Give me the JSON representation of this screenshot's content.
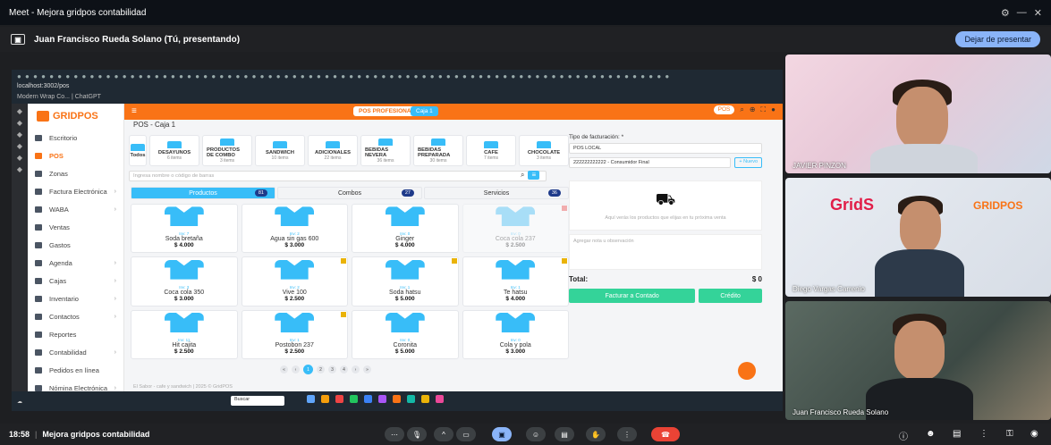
{
  "window": {
    "title": "Meet - Mejora gridpos contabilidad"
  },
  "presenting": {
    "label": "Juan Francisco Rueda Solano (Tú, presentando)",
    "stop_button": "Dejar de presentar"
  },
  "browser": {
    "url": "localhost:3002/pos",
    "bookmarks": "Modern Wrap Co... | ChatGPT",
    "ext_text": "PROD - Co..."
  },
  "app": {
    "logo": "GRIDPOS",
    "badge_profesional": "POS PROFESIONAL",
    "badge_caja": "Caja 1",
    "pos_pill": "POS",
    "page_title": "POS - Caja 1",
    "sidebar": [
      {
        "label": "Escritorio",
        "chev": ""
      },
      {
        "label": "POS",
        "chev": "",
        "active": true
      },
      {
        "label": "Zonas",
        "chev": ""
      },
      {
        "label": "Factura Electrónica",
        "chev": "›"
      },
      {
        "label": "WABA",
        "chev": "›"
      },
      {
        "label": "Ventas",
        "chev": ""
      },
      {
        "label": "Gastos",
        "chev": ""
      },
      {
        "label": "Agenda",
        "chev": "›"
      },
      {
        "label": "Cajas",
        "chev": "›"
      },
      {
        "label": "Inventario",
        "chev": "›"
      },
      {
        "label": "Contactos",
        "chev": "›"
      },
      {
        "label": "Reportes",
        "chev": ""
      },
      {
        "label": "Contabilidad",
        "chev": "›"
      },
      {
        "label": "Pedidos en línea",
        "chev": ""
      },
      {
        "label": "Nómina Electrónica",
        "chev": "›"
      },
      {
        "label": "Adquisiciones",
        "chev": "›"
      },
      {
        "label": "Configuración",
        "chev": "›"
      },
      {
        "label": "Facturación",
        "chev": "›"
      }
    ],
    "categories": [
      {
        "name": "Todos",
        "count": ""
      },
      {
        "name": "DESAYUNOS",
        "count": "6 items"
      },
      {
        "name": "PRODUCTOS DE COMBO",
        "count": "3 items"
      },
      {
        "name": "SANDWICH",
        "count": "10 items"
      },
      {
        "name": "ADICIONALES",
        "count": "22 items"
      },
      {
        "name": "BEBIDAS NEVERA",
        "count": "36 items"
      },
      {
        "name": "BEBIDAS PREPARADA",
        "count": "30 items"
      },
      {
        "name": "CAFE",
        "count": "7 items"
      },
      {
        "name": "CHOCOLATE",
        "count": "3 items"
      }
    ],
    "search_placeholder": "Ingresa nombre o código de barras",
    "tabs": [
      {
        "label": "Productos",
        "count": "81"
      },
      {
        "label": "Combos",
        "count": "27"
      },
      {
        "label": "Servicios",
        "count": "36"
      }
    ],
    "products": [
      {
        "inv": "Inv: 7",
        "name": "Soda bretaña",
        "price": "$ 4.000",
        "badge": ""
      },
      {
        "inv": "Inv: 2",
        "name": "Agua sin gas 600",
        "price": "$ 3.000",
        "badge": ""
      },
      {
        "inv": "Inv: 0",
        "name": "Ginger",
        "price": "$ 4.000",
        "badge": ""
      },
      {
        "inv": "Inv: 0",
        "name": "Coca cola 237",
        "price": "$ 2.500",
        "badge": "red",
        "faded": true
      },
      {
        "inv": "Inv: 3",
        "name": "Coca cola 350",
        "price": "$ 3.000",
        "badge": ""
      },
      {
        "inv": "Inv: 2",
        "name": "Vive 100",
        "price": "$ 2.500",
        "badge": "yellow"
      },
      {
        "inv": "Inv: 1",
        "name": "Soda hatsu",
        "price": "$ 5.000",
        "badge": "yellow"
      },
      {
        "inv": "Inv: 1",
        "name": "Te hatsu",
        "price": "$ 4.000",
        "badge": "yellow"
      },
      {
        "inv": "Inv: 11",
        "name": "Hit cajita",
        "price": "$ 2.500",
        "badge": ""
      },
      {
        "inv": "Inv: 1",
        "name": "Postobon 237",
        "price": "$ 2.500",
        "badge": "yellow"
      },
      {
        "inv": "Inv: 0",
        "name": "Coronita",
        "price": "$ 5.000",
        "badge": ""
      },
      {
        "inv": "Inv: 0",
        "name": "Cola y pola",
        "price": "$ 3.000",
        "badge": ""
      }
    ],
    "pages": [
      "«",
      "‹",
      "1",
      "2",
      "3",
      "4",
      "›",
      "»"
    ],
    "footer": "El Sabor - cafe y sandwich | 2025 © GridPOS",
    "right": {
      "billing_label": "Tipo de facturación: *",
      "billing_value": "POS LOCAL",
      "client_value": "222222222222 - Consumidor Final",
      "new_btn": "+ Nuevo",
      "empty_hint": "Aquí verás los productos que elijas en tu próxima venta",
      "note_placeholder": "Agregar nota u observación",
      "total_label": "Total:",
      "total_value": "$ 0",
      "btn_cash": "Facturar a Contado",
      "btn_credit": "Crédito"
    },
    "taskbar_search": "Buscar"
  },
  "participants": [
    {
      "name": "JAVIER PINZON"
    },
    {
      "name": "Diego Vargas Carrenio"
    },
    {
      "name": "Juan Francisco Rueda Solano"
    }
  ],
  "tile2_logos": {
    "left": "GridS",
    "right": "GRIDPOS"
  },
  "bottom": {
    "time": "18:58",
    "meeting": "Mejora gridpos contabilidad"
  },
  "colors": {
    "accent": "#f97316",
    "blue": "#38bdf8",
    "green": "#34d399",
    "meet_blue": "#8ab4f8",
    "end_call": "#ea4335"
  }
}
